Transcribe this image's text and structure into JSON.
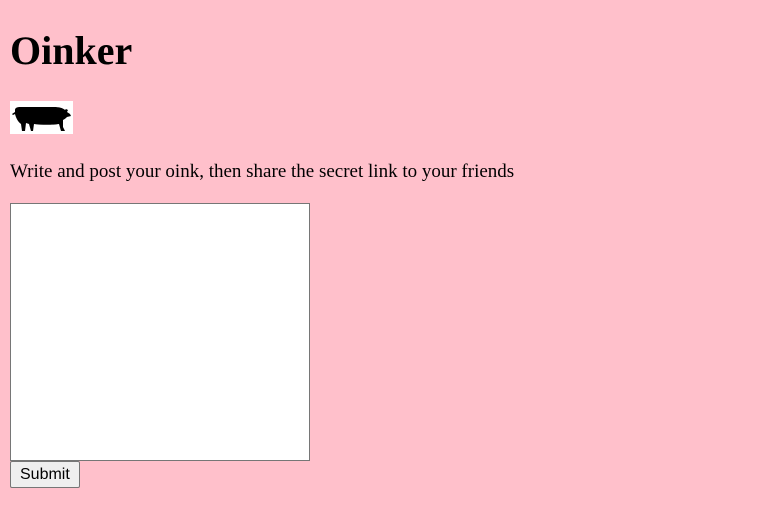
{
  "header": {
    "title": "Oinker"
  },
  "logo": {
    "icon": "pig-icon",
    "color": "#000000",
    "background": "#ffffff"
  },
  "main": {
    "instructions": "Write and post your oink, then share the secret link to your friends",
    "oink_input": {
      "value": "",
      "placeholder": ""
    },
    "submit_label": "Submit"
  },
  "theme": {
    "background": "#ffc0cb"
  }
}
